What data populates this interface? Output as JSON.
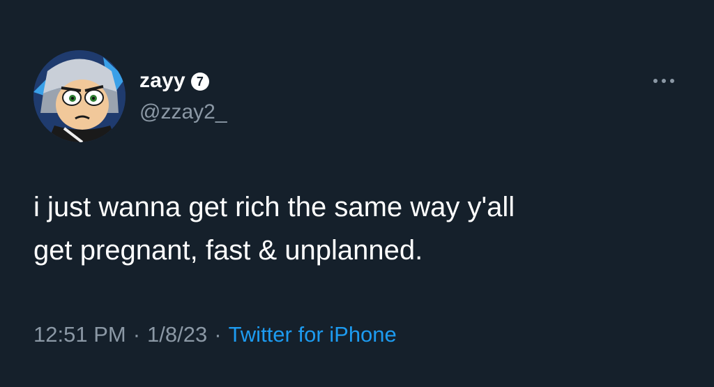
{
  "tweet": {
    "author": {
      "display_name": "zayy",
      "badge": "7",
      "handle": "@zzay2_",
      "avatar_icon": "cartoon-character-avatar"
    },
    "more_icon": "more-horizontal-icon",
    "text_line1": "i just wanna get rich the same way y'all",
    "text_line2": "get pregnant, fast & unplanned.",
    "time": "12:51 PM",
    "date": "1/8/23",
    "separator": "·",
    "source": "Twitter for iPhone"
  },
  "colors": {
    "background": "#15202b",
    "primary_text": "#ffffff",
    "secondary_text": "#8b98a5",
    "link": "#1d9bf0"
  }
}
